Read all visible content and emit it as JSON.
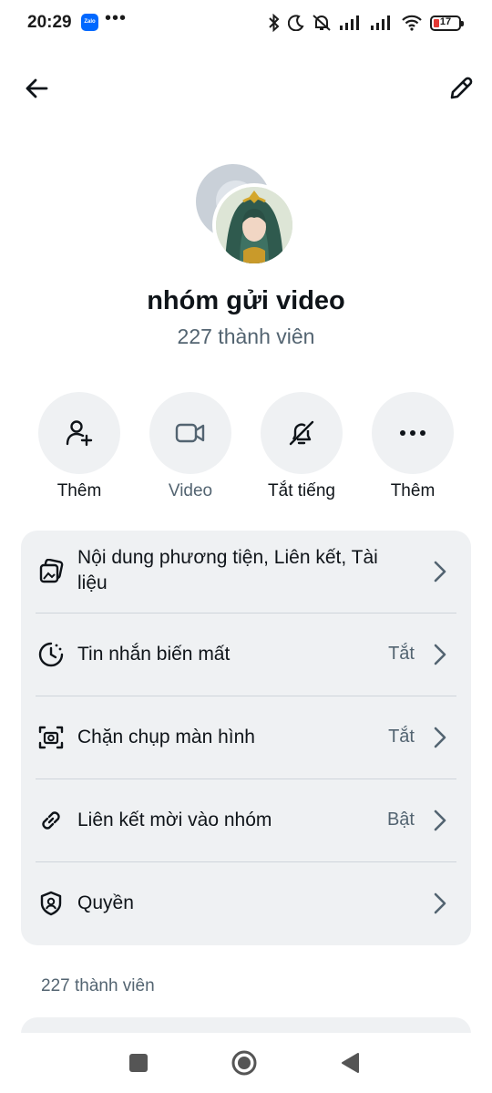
{
  "status_bar": {
    "time": "20:29",
    "zalo_label": "Zalo",
    "more": "•••",
    "battery": "17"
  },
  "group": {
    "name": "nhóm gửi video",
    "member_count": "227 thành viên"
  },
  "actions": [
    {
      "label": "Thêm",
      "icon": "add-user-icon"
    },
    {
      "label": "Video",
      "icon": "video-icon"
    },
    {
      "label": "Tắt tiếng",
      "icon": "mute-bell-icon"
    },
    {
      "label": "Thêm",
      "icon": "more-horizontal-icon"
    }
  ],
  "settings": [
    {
      "label": "Nội dung phương tiện, Liên kết, Tài liệu",
      "value": "",
      "icon": "media-icon"
    },
    {
      "label": "Tin nhắn biến mất",
      "value": "Tắt",
      "icon": "timer-icon"
    },
    {
      "label": "Chặn chụp màn hình",
      "value": "Tắt",
      "icon": "camera-screenshot-icon"
    },
    {
      "label": "Liên kết mời vào nhóm",
      "value": "Bật",
      "icon": "link-icon"
    },
    {
      "label": "Quyền",
      "value": "",
      "icon": "shield-user-icon"
    }
  ],
  "members_section": {
    "header": "227 thành viên"
  },
  "colors": {
    "accent_text": "#0f1419",
    "secondary_text": "#536471",
    "card_bg": "#eff1f3",
    "battery_low": "#e53935"
  }
}
